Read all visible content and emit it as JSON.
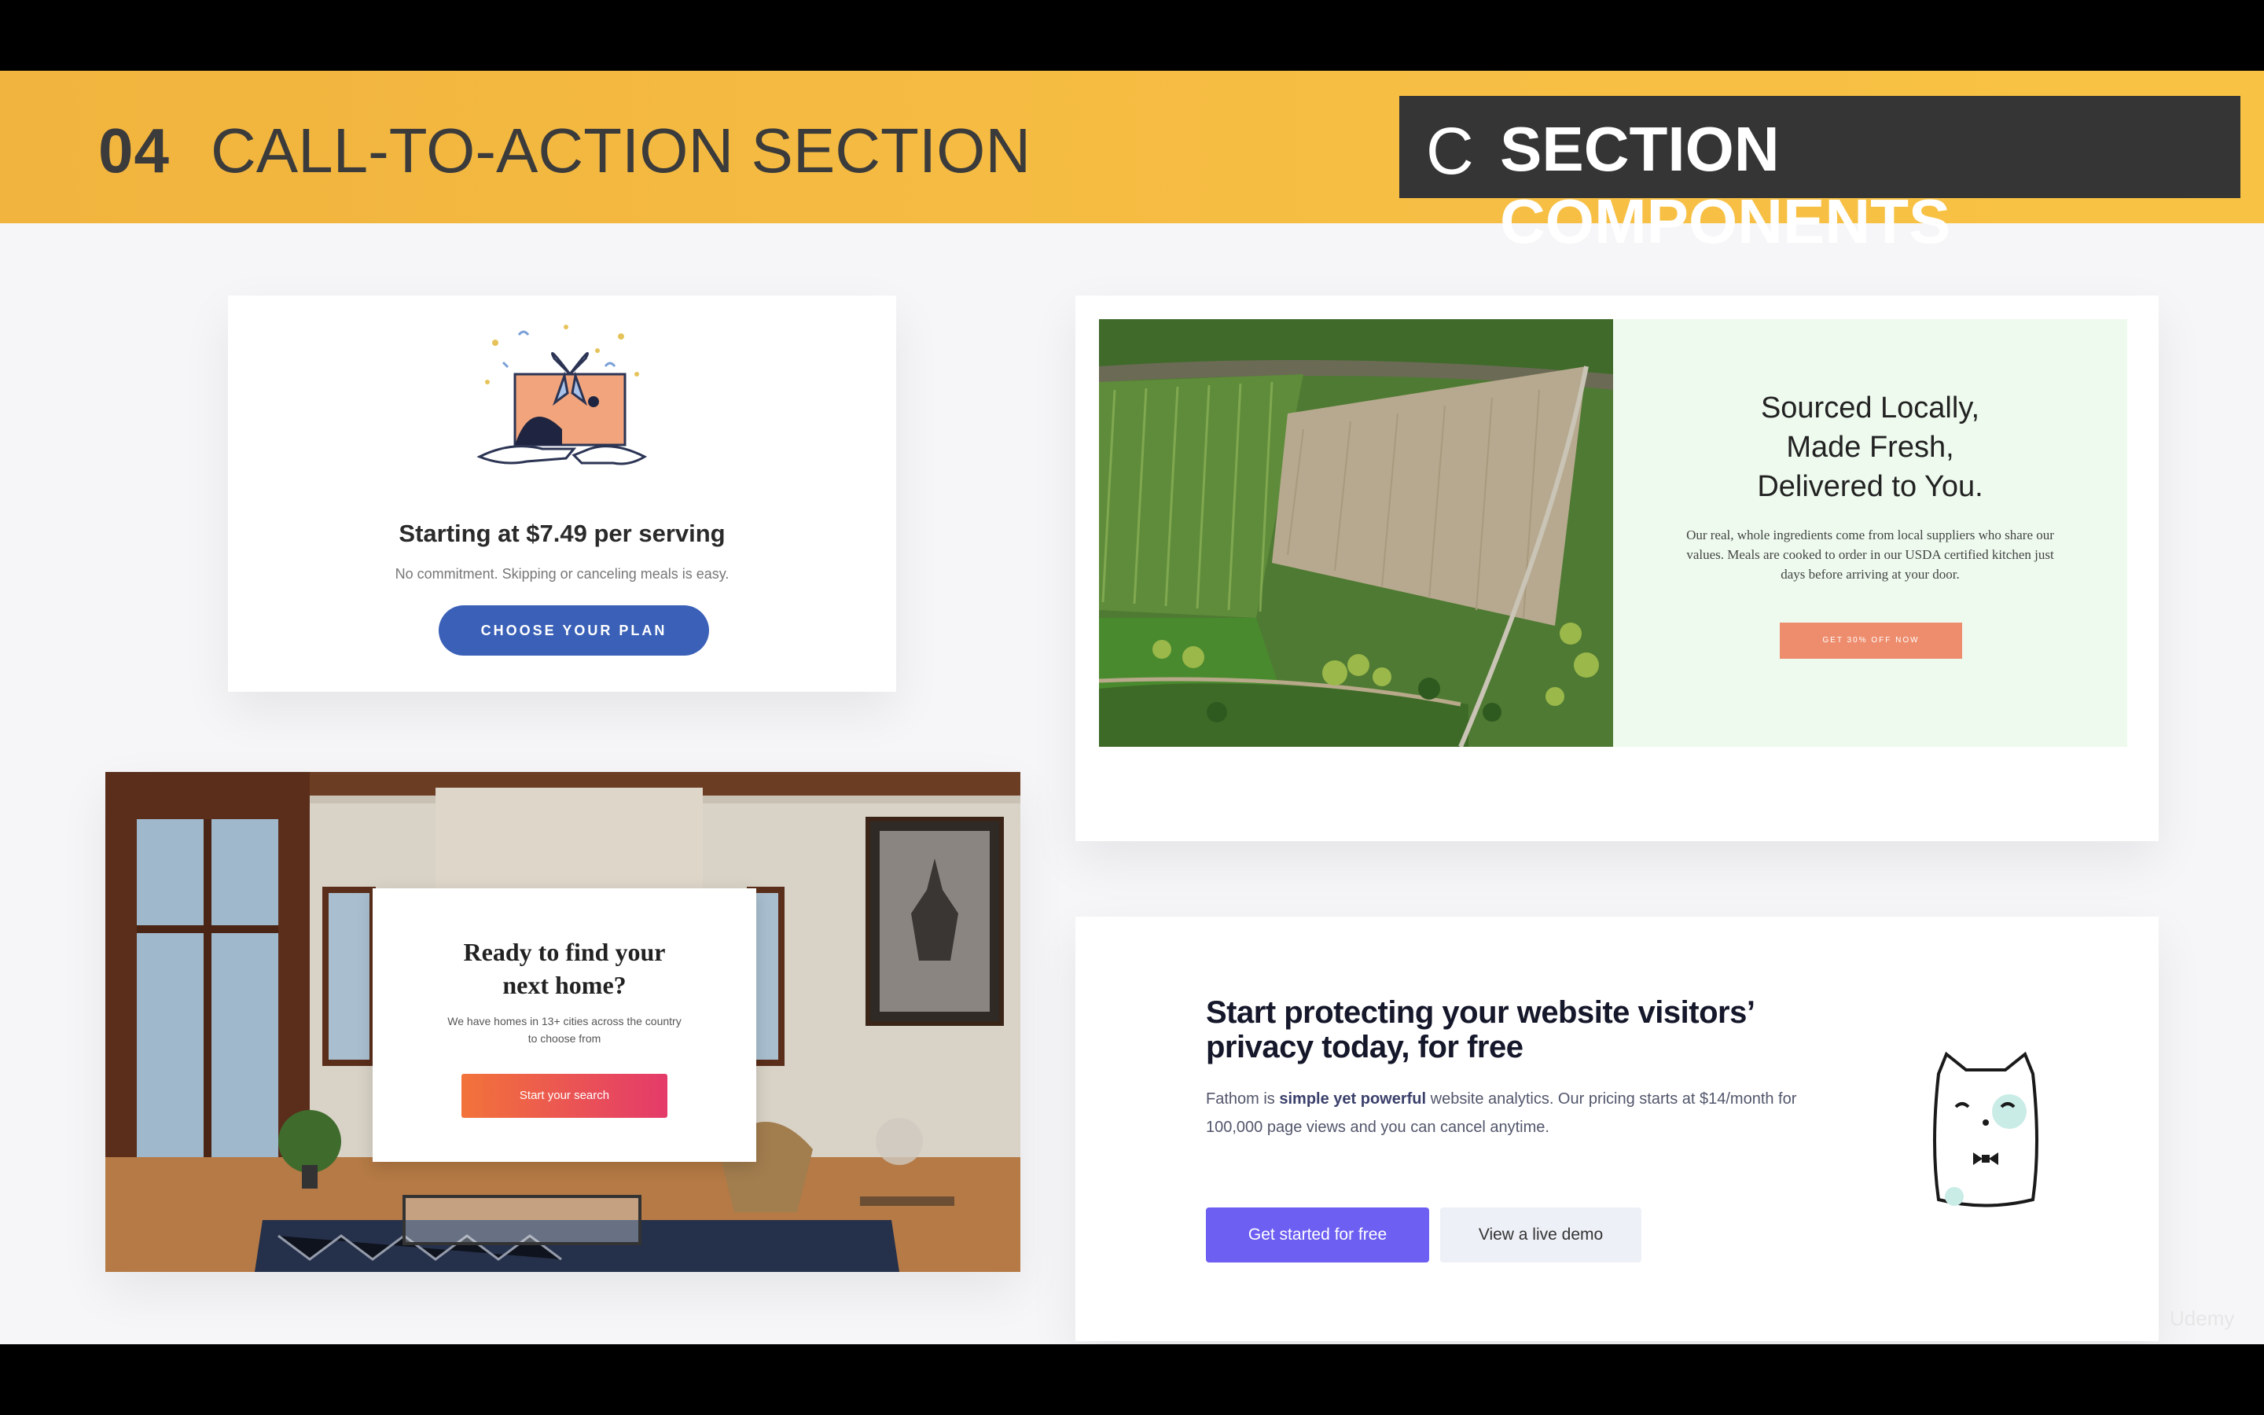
{
  "header": {
    "number": "04",
    "title": "CALL-TO-ACTION SECTION",
    "tag_letter": "C",
    "tag_text": "SECTION COMPONENTS"
  },
  "cards": {
    "meal": {
      "heading": "Starting at $7.49 per serving",
      "subtext": "No commitment. Skipping or canceling meals is easy.",
      "button": "CHOOSE YOUR PLAN"
    },
    "farm": {
      "heading_lines": [
        "Sourced Locally,",
        "Made Fresh,",
        "Delivered to You."
      ],
      "body": "Our real, whole ingredients come from local suppliers who share our values. Meals are cooked to order in our USDA certified kitchen just days before arriving at your door.",
      "button": "GET 30% OFF NOW"
    },
    "home": {
      "heading_lines": [
        "Ready to find your",
        "next home?"
      ],
      "body": "We have homes in 13+ cities across the country to choose from",
      "button": "Start your search"
    },
    "privacy": {
      "heading_lines": [
        "Start protecting your website visitors’",
        "privacy today, for free"
      ],
      "body_prefix": "Fathom is ",
      "body_highlight": "simple yet powerful",
      "body_suffix": " website analytics. Our pricing starts at $14/month for 100,000 page views and you can cancel anytime.",
      "button_primary": "Get started for free",
      "button_secondary": "View a live demo"
    }
  },
  "watermark": "Udemy",
  "colors": {
    "banner": "#f6bd43",
    "tag_bg": "#353535",
    "meal_button": "#3a60b7",
    "farm_panel": "#eefaee",
    "farm_button": "#ee8d6d",
    "privacy_primary": "#6d5ff2"
  },
  "icons": [
    "gift-box-illustration",
    "farm-aerial-image",
    "living-room-photo",
    "cat-mascot-illustration"
  ]
}
